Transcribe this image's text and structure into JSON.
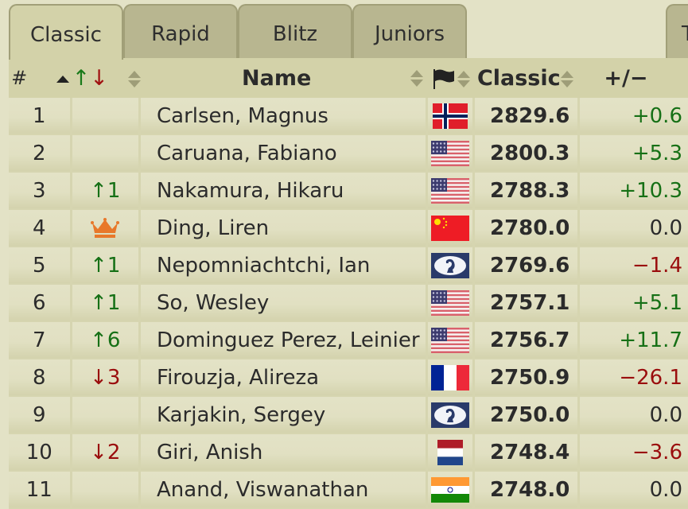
{
  "tabs": [
    {
      "label": "Classic",
      "active": true
    },
    {
      "label": "Rapid",
      "active": false
    },
    {
      "label": "Blitz",
      "active": false
    },
    {
      "label": "Juniors",
      "active": false
    },
    {
      "label": "T",
      "active": false
    }
  ],
  "table": {
    "headers": {
      "rank": "#",
      "movement": "↑↓",
      "name": "Name",
      "flag": "flag",
      "rating": "Classic",
      "delta": "+/−"
    },
    "sort": {
      "column": "rank",
      "direction": "ascending"
    },
    "rows": [
      {
        "rank": "1",
        "move": "",
        "move_dir": "",
        "name": "Carlsen, Magnus",
        "flag": "norway",
        "rating": "2829.6",
        "delta": "+0.6",
        "delta_sign": "pos"
      },
      {
        "rank": "2",
        "move": "",
        "move_dir": "",
        "name": "Caruana, Fabiano",
        "flag": "usa",
        "rating": "2800.3",
        "delta": "+5.3",
        "delta_sign": "pos"
      },
      {
        "rank": "3",
        "move": "1",
        "move_dir": "up",
        "name": "Nakamura, Hikaru",
        "flag": "usa",
        "rating": "2788.3",
        "delta": "+10.3",
        "delta_sign": "pos"
      },
      {
        "rank": "4",
        "move": "",
        "move_dir": "crown",
        "name": "Ding, Liren",
        "flag": "china",
        "rating": "2780.0",
        "delta": "0.0",
        "delta_sign": "zero"
      },
      {
        "rank": "5",
        "move": "1",
        "move_dir": "up",
        "name": "Nepomniachtchi, Ian",
        "flag": "fide",
        "rating": "2769.6",
        "delta": "−1.4",
        "delta_sign": "neg"
      },
      {
        "rank": "6",
        "move": "1",
        "move_dir": "up",
        "name": "So, Wesley",
        "flag": "usa",
        "rating": "2757.1",
        "delta": "+5.1",
        "delta_sign": "pos"
      },
      {
        "rank": "7",
        "move": "6",
        "move_dir": "up",
        "name": "Dominguez Perez, Leinier",
        "flag": "usa",
        "rating": "2756.7",
        "delta": "+11.7",
        "delta_sign": "pos"
      },
      {
        "rank": "8",
        "move": "3",
        "move_dir": "down",
        "name": "Firouzja, Alireza",
        "flag": "france",
        "rating": "2750.9",
        "delta": "−26.1",
        "delta_sign": "neg"
      },
      {
        "rank": "9",
        "move": "",
        "move_dir": "",
        "name": "Karjakin, Sergey",
        "flag": "fide",
        "rating": "2750.0",
        "delta": "0.0",
        "delta_sign": "zero"
      },
      {
        "rank": "10",
        "move": "2",
        "move_dir": "down",
        "name": "Giri, Anish",
        "flag": "netherlands",
        "rating": "2748.4",
        "delta": "−3.6",
        "delta_sign": "neg"
      },
      {
        "rank": "11",
        "move": "",
        "move_dir": "",
        "name": "Anand, Viswanathan",
        "flag": "india",
        "rating": "2748.0",
        "delta": "0.0",
        "delta_sign": "zero"
      }
    ]
  },
  "colors": {
    "positive": "#167016",
    "negative": "#9a0d0d",
    "crown": "#e8782a"
  }
}
